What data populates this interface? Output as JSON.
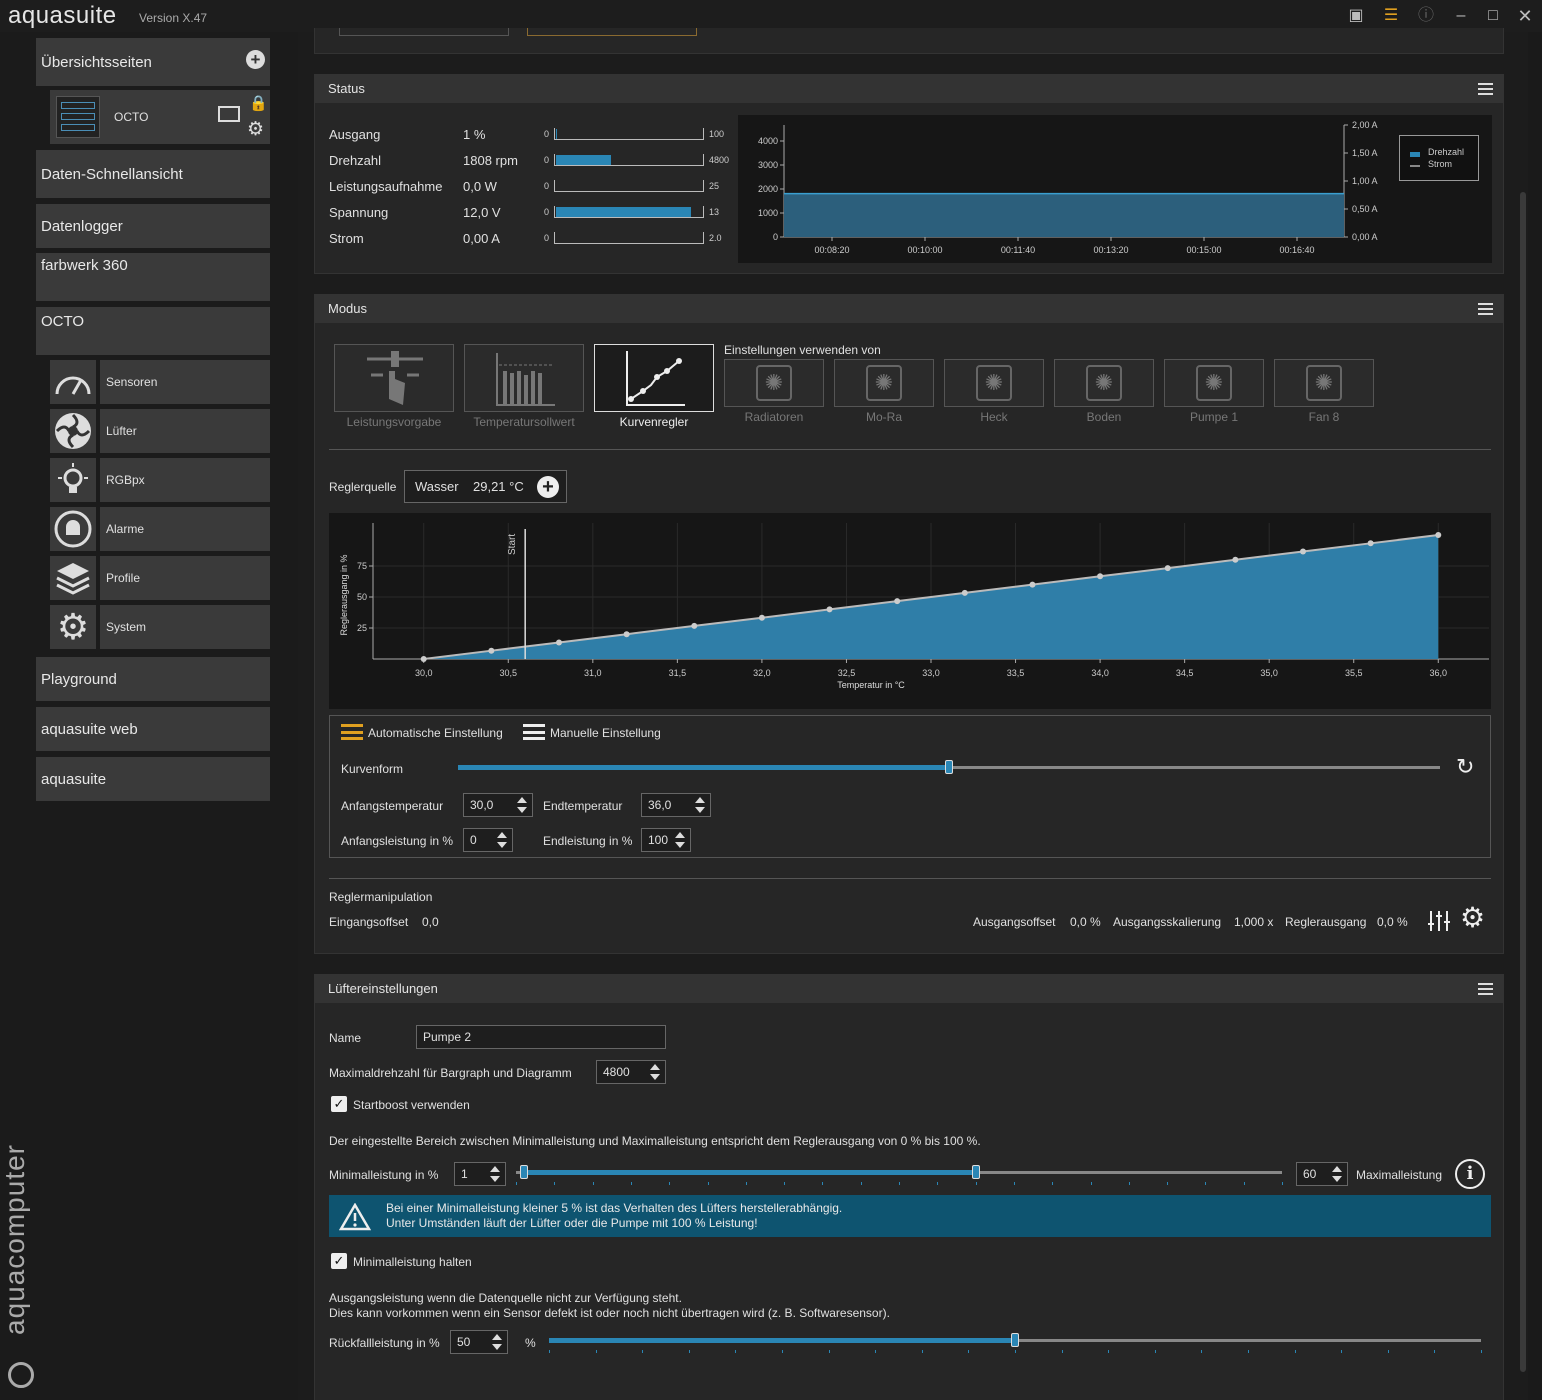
{
  "app": {
    "title": "aquasuite",
    "version": "Version X.47",
    "brand_vertical": "aquacomputer"
  },
  "sidebar": {
    "overview_pages": "Übersichtsseiten",
    "octo_page": "OCTO",
    "quick_view": "Daten-Schnellansicht",
    "datalogger": "Datenlogger",
    "farbwerk": "farbwerk 360",
    "octo": "OCTO",
    "sub_items": [
      {
        "label": "Sensoren",
        "icon": "gauge-icon"
      },
      {
        "label": "Lüfter",
        "icon": "fan-icon"
      },
      {
        "label": "RGBpx",
        "icon": "bulb-icon"
      },
      {
        "label": "Alarme",
        "icon": "bell-icon"
      },
      {
        "label": "Profile",
        "icon": "layers-icon"
      },
      {
        "label": "System",
        "icon": "gear-icon"
      }
    ],
    "playground": "Playground",
    "aquasuite_web": "aquasuite web",
    "aquasuite": "aquasuite"
  },
  "status": {
    "title": "Status",
    "rows": [
      {
        "label": "Ausgang",
        "value": "1 %",
        "min": "0",
        "max": "100",
        "fill": 0.01
      },
      {
        "label": "Drehzahl",
        "value": "1808 rpm",
        "min": "0",
        "max": "4800",
        "fill": 0.377
      },
      {
        "label": "Leistungsaufnahme",
        "value": "0,0 W",
        "min": "0",
        "max": "25",
        "fill": 0
      },
      {
        "label": "Spannung",
        "value": "12,0 V",
        "min": "0",
        "max": "13",
        "fill": 0.923
      },
      {
        "label": "Strom",
        "value": "0,00 A",
        "min": "0",
        "max": "2.0",
        "fill": 0
      }
    ],
    "chart": {
      "left_ticks": [
        "4000",
        "3000",
        "2000",
        "1000",
        "0"
      ],
      "right_ticks": [
        "2,00 A",
        "1,50 A",
        "1,00 A",
        "0,50 A",
        "0,00 A"
      ],
      "x_ticks": [
        "00:08:20",
        "00:10:00",
        "00:11:40",
        "00:13:20",
        "00:15:00",
        "00:16:40"
      ],
      "legend": [
        "Drehzahl",
        "Strom"
      ]
    }
  },
  "modus": {
    "title": "Modus",
    "modes": [
      "Leistungsvorgabe",
      "Temperatursollwert",
      "Kurvenregler"
    ],
    "settings_from": "Einstellungen verwenden von",
    "sources": [
      "Radiatoren",
      "Mo-Ra",
      "Heck",
      "Boden",
      "Pumpe 1",
      "Fan 8"
    ],
    "controller_source_label": "Reglerquelle",
    "controller_source_name": "Wasser",
    "controller_source_value": "29,21 °C",
    "auto_setting": "Automatische Einstellung",
    "manual_setting": "Manuelle Einstellung",
    "curve_shape": "Kurvenform",
    "start_temp_label": "Anfangstemperatur",
    "start_temp": "30,0",
    "end_temp_label": "Endtemperatur",
    "end_temp": "36,0",
    "start_power_label": "Anfangsleistung in %",
    "start_power": "0",
    "end_power_label": "Endleistung in %",
    "end_power": "100",
    "manip_title": "Reglermanipulation",
    "input_offset_label": "Eingangsoffset",
    "input_offset": "0,0",
    "output_offset_label": "Ausgangsoffset",
    "output_offset": "0,0 %",
    "output_scale_label": "Ausgangsskalierung",
    "output_scale": "1,000 x",
    "controller_output_label": "Reglerausgang",
    "controller_output": "0,0 %"
  },
  "chart_data": {
    "type": "area",
    "xlabel": "Temperatur in °C",
    "ylabel": "Reglerausgang in %",
    "x": [
      30.0,
      30.4,
      30.8,
      31.2,
      31.6,
      32.0,
      32.4,
      32.8,
      33.2,
      33.6,
      34.0,
      34.4,
      34.8,
      35.2,
      35.6,
      36.0
    ],
    "values": [
      0,
      6.7,
      13.3,
      20,
      26.7,
      33.3,
      40,
      46.7,
      53.3,
      60,
      66.7,
      73.3,
      80,
      86.7,
      93.3,
      100
    ],
    "xlim": [
      29.7,
      36.3
    ],
    "ylim": [
      0,
      100
    ],
    "x_ticks": [
      "30,0",
      "30,5",
      "31,0",
      "31,5",
      "32,0",
      "32,5",
      "33,0",
      "33,5",
      "34,0",
      "34,5",
      "35,0",
      "35,5",
      "36,0"
    ],
    "y_ticks": [
      "75",
      "50",
      "25"
    ],
    "marker_label": "Start",
    "marker_x": 30.6
  },
  "fan": {
    "title": "Lüftereinstellungen",
    "name_label": "Name",
    "name_value": "Pumpe 2",
    "maxrpm_label": "Maximaldrehzahl für Bargraph und Diagramm",
    "maxrpm_value": "4800",
    "startboost_label": "Startboost verwenden",
    "range_text": "Der eingestellte Bereich zwischen Minimalleistung und Maximalleistung entspricht dem Reglerausgang von 0 % bis 100 %.",
    "min_label": "Minimalleistung in %",
    "min_value": "1",
    "max_value": "60",
    "max_label": "Maximalleistung",
    "min_fraction": 0.01,
    "max_fraction": 0.6,
    "warning_line1": "Bei einer Minimalleistung kleiner 5 % ist das Verhalten des Lüfters herstellerabhängig.",
    "warning_line2": "Unter Umständen läuft der Lüfter oder die Pumpe mit 100 % Leistung!",
    "hold_min_label": "Minimalleistung halten",
    "fallback_text1": "Ausgangsleistung wenn die Datenquelle nicht zur Verfügung steht.",
    "fallback_text2": "Dies kann vorkommen wenn ein Sensor defekt ist oder noch nicht übertragen wird (z. B. Softwaresensor).",
    "fallback_label": "Rückfallleistung in %",
    "fallback_value": "50",
    "fallback_unit": "%",
    "fallback_fraction": 0.5
  },
  "colors": {
    "accent": "#2a86b5",
    "warning_bg": "#0e5470",
    "auto_icon": "#e0a020"
  }
}
